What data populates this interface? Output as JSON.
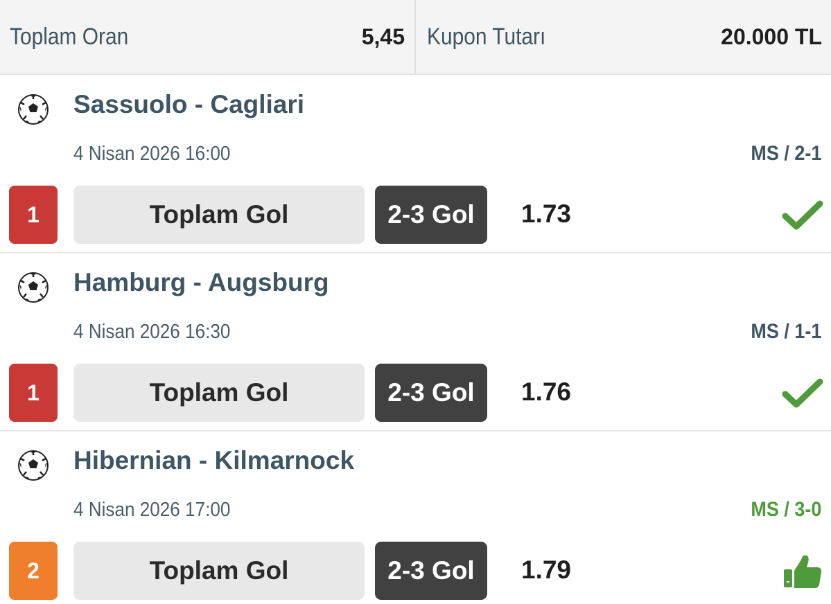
{
  "summary": {
    "total_odds_label": "Toplam Oran",
    "total_odds_value": "5,45",
    "coupon_amount_label": "Kupon Tutarı",
    "coupon_amount_value": "20.000 TL"
  },
  "matches": [
    {
      "teams": "Sassuolo - Cagliari",
      "datetime": "4 Nisan 2026 16:00",
      "score": "MS / 2-1",
      "badge": "1",
      "badge_color": "#c93a36",
      "market": "Toplam Gol",
      "pick": "2-3 Gol",
      "odd": "1.73",
      "result_icon": "checkmark-icon"
    },
    {
      "teams": "Hamburg - Augsburg",
      "datetime": "4 Nisan 2026 16:30",
      "score": "MS / 1-1",
      "badge": "1",
      "badge_color": "#c93a36",
      "market": "Toplam Gol",
      "pick": "2-3 Gol",
      "odd": "1.76",
      "result_icon": "checkmark-icon"
    },
    {
      "teams": "Hibernian - Kilmarnock",
      "datetime": "4 Nisan 2026 17:00",
      "score": "MS / 3-0",
      "badge": "2",
      "badge_color": "#ef7f2c",
      "market": "Toplam Gol",
      "pick": "2-3 Gol",
      "odd": "1.79",
      "result_icon": "thumbs-up-icon"
    }
  ],
  "colors": {
    "team_text": "#3e5663",
    "win_green": "#4f9a3a",
    "pick_bg": "#414141",
    "market_bg": "#e8e8e8"
  }
}
